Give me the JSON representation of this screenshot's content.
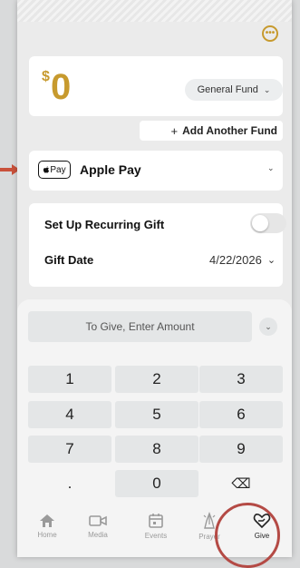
{
  "header": {
    "more_icon": "more-icon"
  },
  "amount": {
    "currency": "$",
    "value": "0",
    "fund": "General Fund"
  },
  "add_fund_label": "Add Another Fund",
  "payment": {
    "badge": "Pay",
    "method": "Apple Pay"
  },
  "recurring": {
    "label": "Set Up Recurring Gift",
    "enabled": false
  },
  "gift_date": {
    "label": "Gift Date",
    "value": "4/22/2026"
  },
  "amount_entry": {
    "placeholder": "To Give, Enter Amount"
  },
  "keypad": {
    "rows": [
      [
        "1",
        "2",
        "3"
      ],
      [
        "4",
        "5",
        "6"
      ],
      [
        "7",
        "8",
        "9"
      ],
      [
        ".",
        "0",
        "⌫"
      ]
    ]
  },
  "nav": [
    {
      "label": "Home",
      "icon": "home-icon",
      "active": false
    },
    {
      "label": "Media",
      "icon": "video-icon",
      "active": false
    },
    {
      "label": "Events",
      "icon": "calendar-icon",
      "active": false
    },
    {
      "label": "Prayer",
      "icon": "prayer-icon",
      "active": false
    },
    {
      "label": "Give",
      "icon": "give-icon",
      "active": true
    }
  ],
  "colors": {
    "accent": "#c79a2e",
    "annotation": "#b44a45",
    "arrow": "#c9513b"
  }
}
